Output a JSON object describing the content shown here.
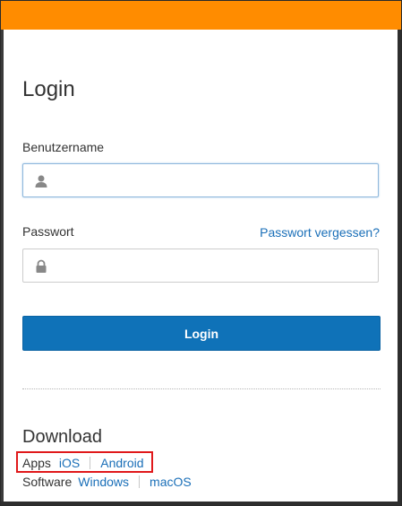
{
  "header": {
    "accent_color": "#ff8c00"
  },
  "login": {
    "title": "Login",
    "username_label": "Benutzername",
    "username_value": "",
    "username_icon": "user-icon",
    "password_label": "Passwort",
    "password_value": "",
    "password_icon": "lock-icon",
    "forgot_link": "Passwort vergessen?",
    "submit_label": "Login",
    "button_color": "#0f72b8",
    "link_color": "#1a6fb8"
  },
  "download": {
    "title": "Download",
    "apps_label": "Apps",
    "apps_links": [
      "iOS",
      "Android"
    ],
    "software_label": "Software",
    "software_links": [
      "Windows",
      "macOS"
    ],
    "highlight_color": "#e0191b"
  }
}
